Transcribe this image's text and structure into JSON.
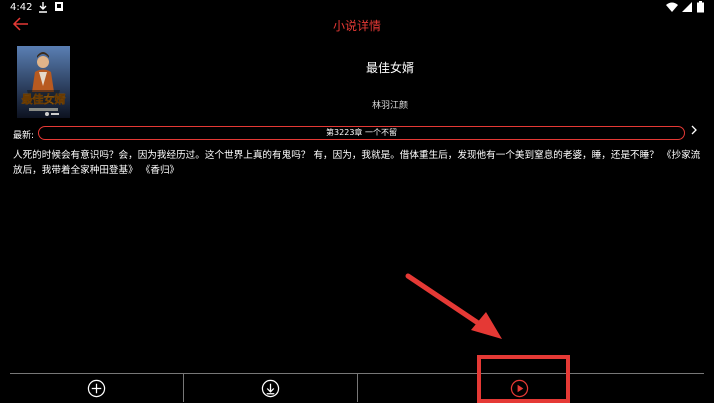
{
  "status_bar": {
    "time": "4:42"
  },
  "appbar": {
    "title": "小说详情"
  },
  "book": {
    "title": "最佳女婿",
    "author": "林羽江颜",
    "cover_text": "最佳女婿"
  },
  "latest": {
    "label": "最新:",
    "chapter": "第3223章 一个不留"
  },
  "description": "人死的时候会有意识吗？会，因为我经历过。这个世界上真的有鬼吗？ 有，因为，我就是。借体重生后，发现他有一个美到窒息的老婆，睡，还是不睡？ 《抄家流放后，我带着全家种田登基》 《香归》",
  "colors": {
    "accent": "#e53935",
    "background": "#000000"
  },
  "bottom_bar": {
    "buttons": [
      {
        "icon": "plus-circle-icon"
      },
      {
        "icon": "download-circle-icon"
      },
      {
        "icon": "play-circle-icon"
      }
    ]
  }
}
